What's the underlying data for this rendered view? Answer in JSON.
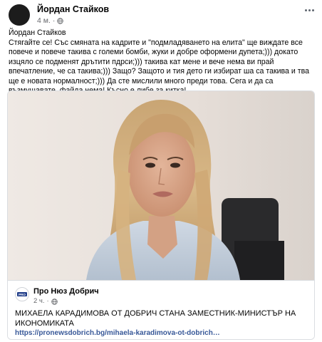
{
  "post": {
    "author": "Йордан Стайков",
    "time": "4 м.",
    "separator": "·",
    "text_author": "Йордан Стайков",
    "text_body": "Стягайте се! Със смяната на кадрите и \"подмладяването на елита\" ще виждате все повече и повече такива с големи бомби, жуки и добре оформени дупета;))) докато изцяло се подменят дрътити пдрси;))) такива кат мене и вече нема ви прай впечатление, че са такива;))) Защо? Защото и тия дето ги избират ша са такива и тва ще е новата нормалност;))) Да сте мислили много преди това. Сега и да са възмущавате, файда нема! Късно е либе за китка!"
  },
  "link": {
    "source_name": "Про Нюз Добрич",
    "source_time": "2 ч.",
    "separator": "·",
    "headline": "МИХАЕЛА КАРАДИМОВА ОТ ДОБРИЧ СТАНА ЗАМЕСТНИК-МИНИСТЪР НА ИКОНОМИКАТА",
    "url": "https://pronewsdobrich.bg/mihaela-karadimova-ot-dobrich…",
    "logo_text": "PRO"
  },
  "icons": {
    "privacy": "globe-icon",
    "menu": "more-options-icon"
  },
  "colors": {
    "link_blue": "#385898",
    "meta_gray": "#65676b",
    "border": "#dadde1"
  }
}
